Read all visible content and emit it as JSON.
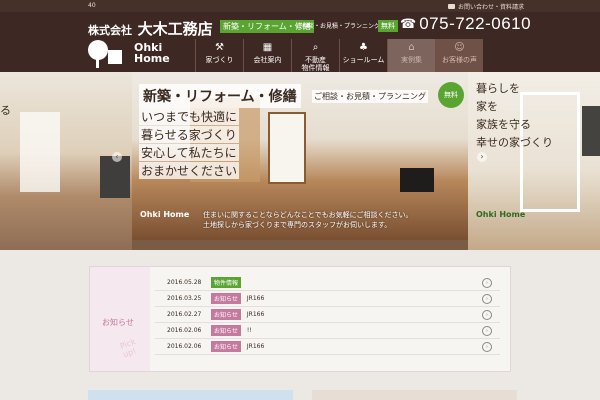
{
  "topbar": {
    "number": "40",
    "contact_label": "お問い合わせ・資料請求"
  },
  "header": {
    "company_prefix": "株式会社",
    "company_name": "大木工務店",
    "tag_main": "新築・リフォーム・修繕",
    "tag_sub": "ご相談・お見積・プランニング",
    "tag_free": "無料",
    "phone": "075-722-0610"
  },
  "logo": {
    "line1": "Ohki",
    "line2": "Home"
  },
  "nav": [
    {
      "label": "家づくり",
      "icon": "hammer-icon"
    },
    {
      "label": "会社案内",
      "icon": "building-icon"
    },
    {
      "label": "不動産\n物件情報",
      "icon": "search-house-icon"
    },
    {
      "label": "ショールーム",
      "icon": "sprout-icon"
    },
    {
      "label": "実例集",
      "icon": "home-icon"
    },
    {
      "label": "お客様の声",
      "icon": "people-icon"
    }
  ],
  "hero": {
    "title": "新築・リフォーム・修繕",
    "sub": "ご相談・お見積・プランニング",
    "free": "無料",
    "lines": [
      "いつまでも快適に",
      "暮らせる家づくり",
      "安心して私たちに",
      "おまかせください"
    ],
    "caption1": "住まいに関することならどんなことでもお気軽にご相談ください。",
    "caption2": "土地探しから家づくりまで専門のスタッフがお伺いします。",
    "logo_text": "Ohki Home",
    "right_lines": [
      "暮らしを",
      "家を",
      "家族を守る",
      "幸せの家づくり"
    ],
    "left_text": "る",
    "slides_total": 5,
    "slide_active": 0
  },
  "news": {
    "title": "お知らせ",
    "pickup": "Pick up!",
    "items": [
      {
        "date": "2016.05.28",
        "category": "物件情報",
        "cat_color": "green",
        "title": ""
      },
      {
        "date": "2016.03.25",
        "category": "お知らせ",
        "cat_color": "pink",
        "title": "JR166"
      },
      {
        "date": "2016.02.27",
        "category": "お知らせ",
        "cat_color": "pink",
        "title": "JR166"
      },
      {
        "date": "2016.02.06",
        "category": "お知らせ",
        "cat_color": "pink",
        "title": "!!"
      },
      {
        "date": "2016.02.06",
        "category": "お知らせ",
        "cat_color": "pink",
        "title": "JR166"
      }
    ]
  }
}
